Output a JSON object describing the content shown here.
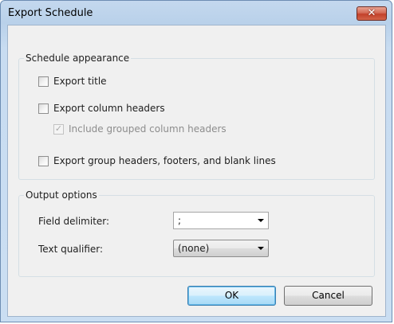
{
  "window": {
    "title": "Export Schedule",
    "close_glyph": "✕"
  },
  "appearance": {
    "group_title": "Schedule appearance",
    "export_title": {
      "label": "Export title",
      "checked": false,
      "enabled": true
    },
    "export_column_headers": {
      "label": "Export column headers",
      "checked": false,
      "enabled": true
    },
    "include_grouped_headers": {
      "label": "Include grouped column headers",
      "checked": true,
      "enabled": false
    },
    "export_group_headers": {
      "label": "Export group headers, footers, and blank lines",
      "checked": false,
      "enabled": true
    }
  },
  "output": {
    "group_title": "Output options",
    "field_delimiter": {
      "label": "Field delimiter:",
      "value": ";"
    },
    "text_qualifier": {
      "label": "Text qualifier:",
      "value": "(none)"
    }
  },
  "buttons": {
    "ok": "OK",
    "cancel": "Cancel"
  },
  "icons": {
    "close": "close-icon",
    "dropdown": "chevron-down-icon",
    "check": "checkmark-icon"
  },
  "colors": {
    "title_bar": "#b9d1ea",
    "close_button": "#c2412a",
    "client_background": "#f0f0f0",
    "default_button_border": "#3c7fb1",
    "disabled_text": "#8d8d8d"
  }
}
